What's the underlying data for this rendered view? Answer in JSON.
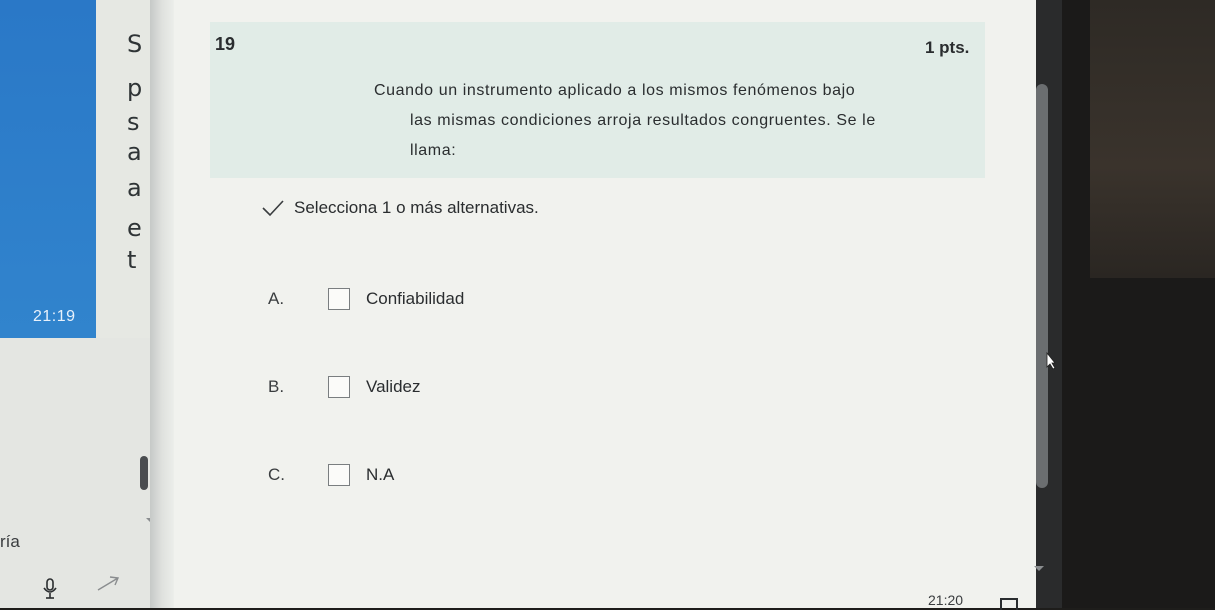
{
  "left_panel": {
    "clock": "21:19",
    "side_letters": [
      "S",
      "p",
      "s",
      "a",
      "a",
      "e",
      "t"
    ],
    "partial_text": "ría"
  },
  "question": {
    "number": "19",
    "points": "1 pts.",
    "text_lines": [
      "Cuando un instrumento aplicado a los mismos fenómenos bajo",
      "las mismas condiciones arroja resultados congruentes. Se le",
      "llama:"
    ],
    "hint": "Selecciona 1 o más alternativas."
  },
  "options": [
    {
      "letter": "A.",
      "label": "Confiabilidad",
      "checked": false
    },
    {
      "letter": "B.",
      "label": "Validez",
      "checked": false
    },
    {
      "letter": "C.",
      "label": "N.A",
      "checked": false
    }
  ],
  "taskbar": {
    "clock": "21:20"
  },
  "icons": {
    "check": "check-icon",
    "mic": "mic-icon",
    "arrow": "arrow-icon"
  }
}
